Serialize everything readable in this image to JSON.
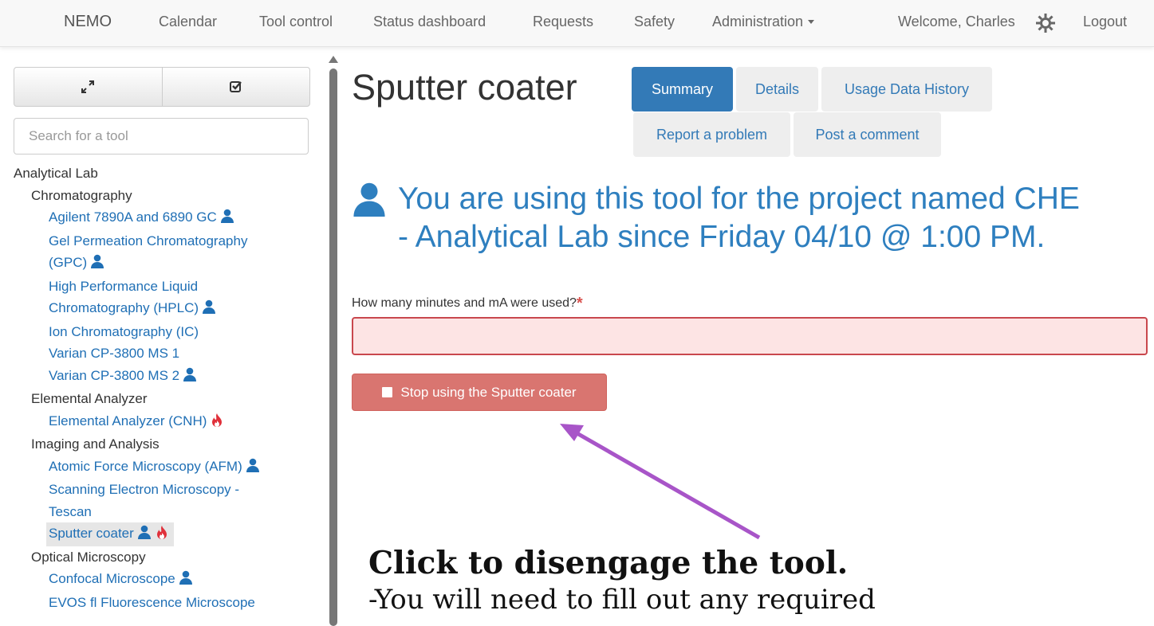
{
  "nav": {
    "brand": "NEMO",
    "items": [
      "Calendar",
      "Tool control",
      "Status dashboard",
      "Requests",
      "Safety",
      "Administration"
    ],
    "welcome": "Welcome, Charles",
    "logout": "Logout"
  },
  "sidebar": {
    "search_placeholder": "Search for a tool",
    "tree": {
      "cat1": "Analytical Lab",
      "sub1": "Chromatography",
      "t1": "Agilent 7890A and 6890 GC",
      "t2a": "Gel Permeation Chromatography",
      "t2b": "(GPC)",
      "t3a": "High Performance Liquid",
      "t3b": "Chromatography (HPLC)",
      "t4": "Ion Chromatography (IC)",
      "t5": "Varian CP-3800 MS 1",
      "t6": "Varian CP-3800 MS 2",
      "sub2": "Elemental Analyzer",
      "t7": "Elemental Analyzer (CNH)",
      "sub3": "Imaging and Analysis",
      "t8": "Atomic Force Microscopy (AFM)",
      "t9a": "Scanning Electron Microscopy -",
      "t9b": "Tescan",
      "t10": "Sputter coater",
      "sub4": "Optical Microscopy",
      "t11": "Confocal Microscope",
      "t12": "EVOS fl Fluorescence Microscope"
    }
  },
  "main": {
    "title": "Sputter coater",
    "tabs": {
      "summary": "Summary",
      "details": "Details",
      "usage": "Usage Data History",
      "report": "Report a problem",
      "comment": "Post a comment"
    },
    "banner_line1": "You are using this tool for the project named CHE",
    "banner_line2": "- Analytical Lab since Friday 04/10 @ 1:00 PM.",
    "question": "How many minutes and mA were used?",
    "required_mark": "*",
    "stop_button": "Stop using the Sputter coater"
  },
  "annotation": {
    "title": "Click to disengage the tool.",
    "subtitle": "-You will need to fill out any required"
  },
  "colors": {
    "link": "#1f6fb5",
    "primary": "#337ab7",
    "danger_button": "#d97570",
    "arrow": "#a855c8",
    "flame": "#e0303a"
  }
}
